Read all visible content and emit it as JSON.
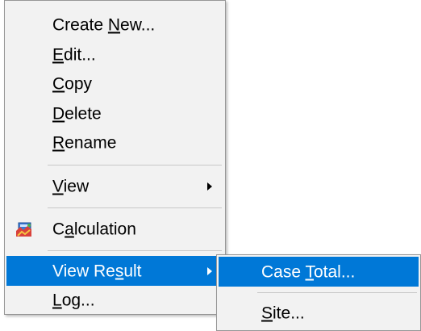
{
  "context_menu": {
    "items": [
      {
        "pre": "Create ",
        "key": "N",
        "post": "ew..."
      },
      {
        "pre": "",
        "key": "E",
        "post": "dit..."
      },
      {
        "pre": "",
        "key": "C",
        "post": "opy"
      },
      {
        "pre": "",
        "key": "D",
        "post": "elete"
      },
      {
        "pre": "",
        "key": "R",
        "post": "ename"
      },
      {
        "pre": "",
        "key": "V",
        "post": "iew",
        "submenu": true
      },
      {
        "pre": "C",
        "key": "a",
        "post": "lculation",
        "icon": "calculation-icon"
      },
      {
        "pre": "View Re",
        "key": "s",
        "post": "ult",
        "submenu": true,
        "highlighted": true
      },
      {
        "pre": "",
        "key": "L",
        "post": "og..."
      }
    ]
  },
  "submenu_view_result": {
    "items": [
      {
        "pre": "Case ",
        "key": "T",
        "post": "otal...",
        "highlighted": true
      },
      {
        "pre": "",
        "key": "S",
        "post": "ite..."
      }
    ]
  },
  "colors": {
    "menu_background": "#f2f2f2",
    "highlight": "#0078d7",
    "separator": "#c8c8c8",
    "border": "#979797"
  }
}
